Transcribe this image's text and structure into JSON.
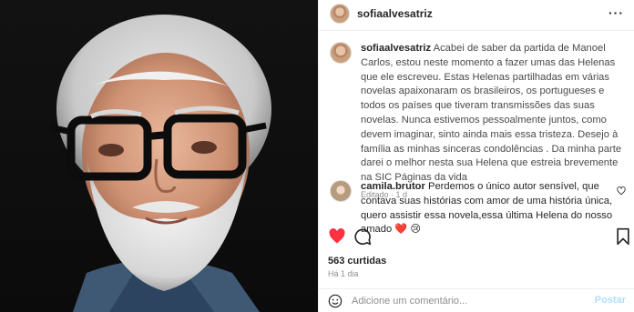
{
  "header": {
    "username": "sofiaalvesatriz",
    "more_icon": "more-horizontal-icon"
  },
  "caption": {
    "username": "sofiaalvesatriz",
    "text": "Acabei de saber da partida de Manoel Carlos, estou neste momento a fazer umas das Helenas que ele escreveu. Estas Helenas partilhadas em várias novelas apaixonaram os brasileiros, os portugueses e todos os países que tiveram transmissões das suas novelas. Nunca estivemos pessoalmente juntos, como devem imaginar, sinto ainda mais essa tristeza. Desejo à família as minhas sinceras condolências . Da minha parte darei o melhor nesta sua Helena que estreia brevemente na SIC Páginas da vida",
    "meta": "Editado · 1 d"
  },
  "comment": {
    "username": "camila.brutor",
    "text": "Perdemos o único autor sensível, que contava suas histórias com amor de uma história única, quero assistir essa novela,essa última Helena do nosso amado ❤️ 😢"
  },
  "actions": {
    "like_icon": "heart-filled-icon",
    "comment_icon": "comment-bubble-icon",
    "save_icon": "bookmark-icon",
    "like_color": "#ff3040"
  },
  "likes": "563 curtidas",
  "timestamp": "Há 1 dia",
  "add_comment": {
    "placeholder": "Adicione um comentário...",
    "post_label": "Postar",
    "post_color": "#b2dffc"
  }
}
